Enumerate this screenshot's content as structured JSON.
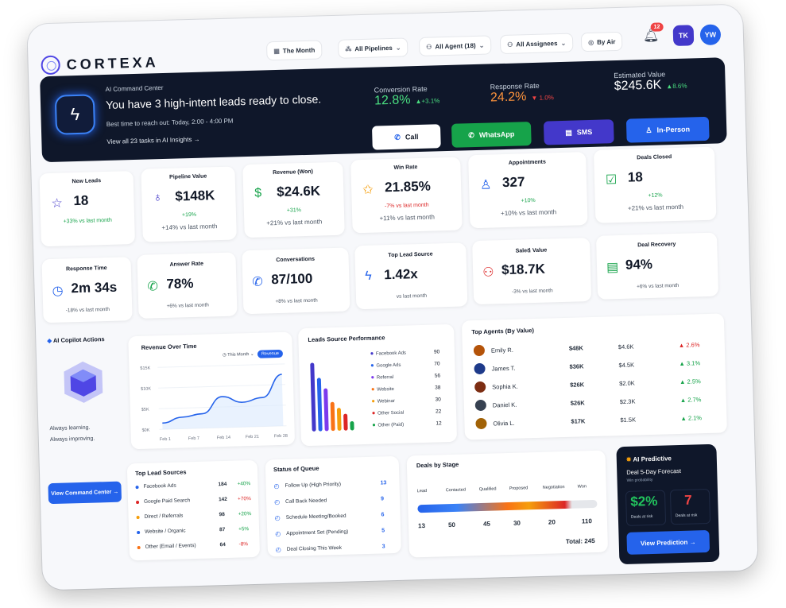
{
  "brand": {
    "name": "CORTEXA"
  },
  "filters": [
    {
      "label": "The Month",
      "icon": "calendar-icon"
    },
    {
      "label": "All Pipelines",
      "icon": "pipeline-icon"
    },
    {
      "label": "All Agent (18)",
      "icon": "agent-icon"
    },
    {
      "label": "All Assignees",
      "icon": "assignees-icon"
    },
    {
      "label": "By Air",
      "icon": "filter-icon"
    }
  ],
  "notifications": {
    "count": "12"
  },
  "avatars": [
    {
      "initials": "TK",
      "color": "#4338ca"
    },
    {
      "initials": "YW",
      "color": "#2563eb"
    }
  ],
  "hero": {
    "label": "AI Command Center",
    "headline": "You have 3 high-intent leads ready to close.",
    "best_time": "Best time to reach out: Today, 2:00 - 4:00 PM",
    "link": "View all 23 tasks in AI Insights →",
    "metrics": [
      {
        "title": "Conversion Rate",
        "value": "12.8%",
        "delta": "▲+3.1%",
        "value_color": "#4ade80",
        "delta_color": "#4ade80"
      },
      {
        "title": "Response Rate",
        "value": "24.2%",
        "delta": "▼ 1.0%",
        "value_color": "#fb923c",
        "delta_color": "#ef4444"
      },
      {
        "title": "Estimated Value",
        "value": "$245.6K",
        "delta": "▲8.6%",
        "value_color": "#ffffff",
        "delta_color": "#4ade80"
      }
    ],
    "buttons": [
      {
        "label": "Call",
        "icon": "phone-icon"
      },
      {
        "label": "WhatsApp",
        "icon": "whatsapp-icon"
      },
      {
        "label": "SMS",
        "icon": "sms-icon"
      },
      {
        "label": "In-Person",
        "icon": "person-icon"
      }
    ]
  },
  "stats_row1": [
    {
      "title": "New Leads",
      "value": "18",
      "delta": "+33% vs last month",
      "sub": "",
      "icon": "star-icon",
      "glyph": "☆",
      "color": "#4338ca"
    },
    {
      "title": "Pipeline Value",
      "value": "$148K",
      "delta": "+19%",
      "sub": "+14% vs last month",
      "icon": "moneybag-icon",
      "glyph": "♁",
      "color": "#4338ca"
    },
    {
      "title": "Revenue (Won)",
      "value": "$24.6K",
      "delta": "+31%",
      "sub": "+21% vs last month",
      "icon": "dollar-icon",
      "glyph": "$",
      "color": "#16a34a"
    },
    {
      "title": "Win Rate",
      "value": "21.85%",
      "delta": "-7% vs last month",
      "sub": "+11% vs last month",
      "icon": "award-icon",
      "glyph": "✩",
      "color": "#f59e0b"
    },
    {
      "title": "Appointments",
      "value": "327",
      "delta": "+10%",
      "sub": "+10% vs last month",
      "icon": "user-icon",
      "glyph": "♙",
      "color": "#2563eb"
    },
    {
      "title": "Deals Closed",
      "value": "18",
      "delta": "+12%",
      "sub": "+21% vs last month",
      "icon": "deals-icon",
      "glyph": "☑",
      "color": "#16a34a"
    }
  ],
  "stats_row2": [
    {
      "title": "Response Time",
      "value": "2m 34s",
      "sub": "-18% vs last month",
      "icon": "clock-icon",
      "glyph": "◷",
      "color": "#2563eb"
    },
    {
      "title": "Answer Rate",
      "value": "78%",
      "sub": "+6% vs last month",
      "icon": "whatsapp-icon",
      "glyph": "✆",
      "color": "#16a34a"
    },
    {
      "title": "Conversations",
      "value": "87/100",
      "sub": "+8% vs last month",
      "icon": "chat-icon",
      "glyph": "✆",
      "color": "#2563eb"
    },
    {
      "title": "Top Lead Source",
      "value": "1.42x",
      "sub": "vs last month",
      "icon": "bolt-icon",
      "glyph": "ϟ",
      "color": "#2563eb"
    },
    {
      "title": "Sale៥ Value",
      "value": "$18.7K",
      "sub": "-3% vs last month",
      "icon": "robot-icon",
      "glyph": "⚇",
      "color": "#dc2626"
    },
    {
      "title": "Deal Recovery",
      "value": "94%",
      "sub": "+6% vs last month",
      "icon": "document-icon",
      "glyph": "▤",
      "color": "#16a34a"
    }
  ],
  "copilot": {
    "title": "AI Copilot Actions",
    "line1": "Always learning.",
    "line2": "Always improving.",
    "button": "View Command Center →"
  },
  "revenue": {
    "title": "Revenue Over Time",
    "range": "This Month",
    "toggle": "Revenue"
  },
  "chart_data": [
    {
      "type": "line",
      "title": "Revenue Over Time",
      "x": [
        "Feb 1",
        "Feb 7",
        "Feb 14",
        "Feb 21",
        "Feb 28"
      ],
      "y_ticks": [
        "$15K",
        "$10K",
        "$5K",
        "$0K"
      ],
      "ylim": [
        0,
        15000
      ],
      "series": [
        {
          "values": [
            1500,
            2800,
            3500,
            7500,
            6000,
            7000,
            12500
          ]
        }
      ]
    },
    {
      "type": "bar",
      "title": "Leads Source Performance",
      "categories": [
        "Facebook Ads",
        "Google Ads",
        "Referral",
        "Website",
        "Webinar",
        "Other Social",
        "Other (Paid)"
      ],
      "values": [
        90,
        70,
        56,
        38,
        30,
        22,
        12
      ]
    }
  ],
  "leads_source": {
    "title": "Leads Source Performance",
    "items": [
      {
        "name": "Facebook Ads",
        "value": "90",
        "color": "#4338ca"
      },
      {
        "name": "Google Ads",
        "value": "70",
        "color": "#2563eb"
      },
      {
        "name": "Referral",
        "value": "56",
        "color": "#7c3aed"
      },
      {
        "name": "Website",
        "value": "38",
        "color": "#f97316"
      },
      {
        "name": "Webinar",
        "value": "30",
        "color": "#f59e0b"
      },
      {
        "name": "Other Social",
        "value": "22",
        "color": "#dc2626"
      },
      {
        "name": "Other (Paid)",
        "value": "12",
        "color": "#16a34a"
      }
    ]
  },
  "top_agents": {
    "title": "Top Agents (By Value)",
    "rows": [
      {
        "name": "Emily R.",
        "value": "$48K",
        "avg": "$4.6K",
        "delta": "▲ 2.6%",
        "color": "#dc2626"
      },
      {
        "name": "James T.",
        "value": "$36K",
        "avg": "$4.5K",
        "delta": "▲ 3.1%",
        "color": "#16a34a"
      },
      {
        "name": "Sophia K.",
        "value": "$26K",
        "avg": "$2.0K",
        "delta": "▲ 2.5%",
        "color": "#16a34a"
      },
      {
        "name": "Daniel K.",
        "value": "$26K",
        "avg": "$2.3K",
        "delta": "▲ 2.7%",
        "color": "#16a34a"
      },
      {
        "name": "Olivia L.",
        "value": "$17K",
        "avg": "$1.5K",
        "delta": "▲ 2.1%",
        "color": "#16a34a"
      }
    ]
  },
  "top_sources": {
    "title": "Top Lead Sources",
    "rows": [
      {
        "name": "Facebook Ads",
        "count": "184",
        "delta": "+40%",
        "color": "#16a34a",
        "dot": "#2563eb"
      },
      {
        "name": "Google Paid Search",
        "count": "142",
        "delta": "+70%",
        "color": "#dc2626",
        "dot": "#dc2626"
      },
      {
        "name": "Direct / Referrals",
        "count": "98",
        "delta": "+20%",
        "color": "#16a34a",
        "dot": "#f59e0b"
      },
      {
        "name": "Website / Organic",
        "count": "87",
        "delta": "+5%",
        "color": "#16a34a",
        "dot": "#2563eb"
      },
      {
        "name": "Other (Email / Events)",
        "count": "64",
        "delta": "-8%",
        "color": "#dc2626",
        "dot": "#f97316"
      }
    ]
  },
  "queue": {
    "title": "Status of Queue",
    "rows": [
      {
        "name": "Follow Up (High Priority)",
        "count": "13"
      },
      {
        "name": "Call Back Needed",
        "count": "9"
      },
      {
        "name": "Schedule Meeting/Booked",
        "count": "6"
      },
      {
        "name": "Appointment Set (Pending)",
        "count": "5"
      },
      {
        "name": "Deal Closing This Week",
        "count": "3"
      }
    ]
  },
  "deals": {
    "title": "Deals by Stage",
    "stages": [
      "Lead",
      "Contacted",
      "Qualified",
      "Proposed",
      "Negotiation",
      "Won"
    ],
    "values": [
      "13",
      "50",
      "45",
      "30",
      "20",
      "110"
    ],
    "total": "Total: 245"
  },
  "predictive": {
    "title": "AI Predictive",
    "subtitle": "Deal 5-Day Forecast",
    "note": "Win probability",
    "pct": "$2%",
    "pct_label": "Deals at risk",
    "risk": "7",
    "risk_label": "Deals at risk",
    "button": "View Prediction →"
  }
}
